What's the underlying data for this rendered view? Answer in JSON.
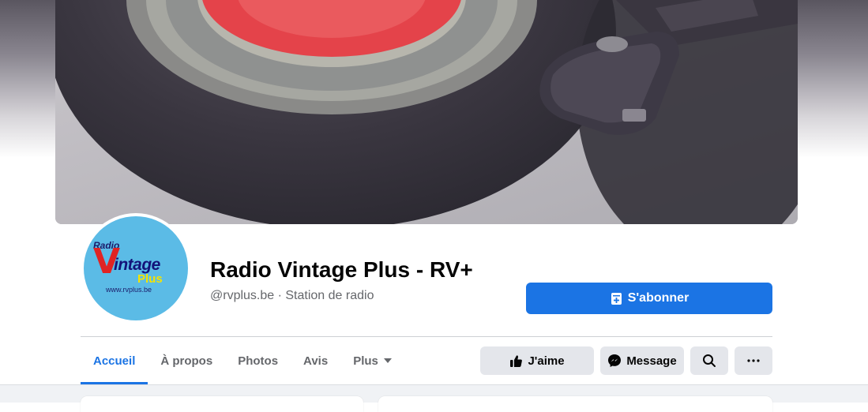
{
  "page": {
    "name": "Radio Vintage Plus - RV+",
    "handle_category": "@rvplus.be · Station de radio"
  },
  "logo": {
    "radio": "Radio",
    "v": "V",
    "intage": "intage",
    "plus": "Plus",
    "url": "www.rvplus.be"
  },
  "buttons": {
    "subscribe": "S'abonner",
    "like": "J'aime",
    "message": "Message"
  },
  "tabs": [
    {
      "label": "Accueil",
      "active": true
    },
    {
      "label": "À propos",
      "active": false
    },
    {
      "label": "Photos",
      "active": false
    },
    {
      "label": "Avis",
      "active": false
    },
    {
      "label": "Plus",
      "active": false
    }
  ],
  "colors": {
    "accent": "#1b74e4",
    "secondary_button": "#e4e6eb",
    "feed_background": "#f0f2f5",
    "record_label": "#e4434a"
  },
  "icons": {
    "subscribe": "add-to-feed-icon",
    "like": "thumbs-up-icon",
    "message": "messenger-icon",
    "search": "search-icon",
    "more": "ellipsis-icon",
    "plus_dropdown": "caret-down-icon"
  }
}
